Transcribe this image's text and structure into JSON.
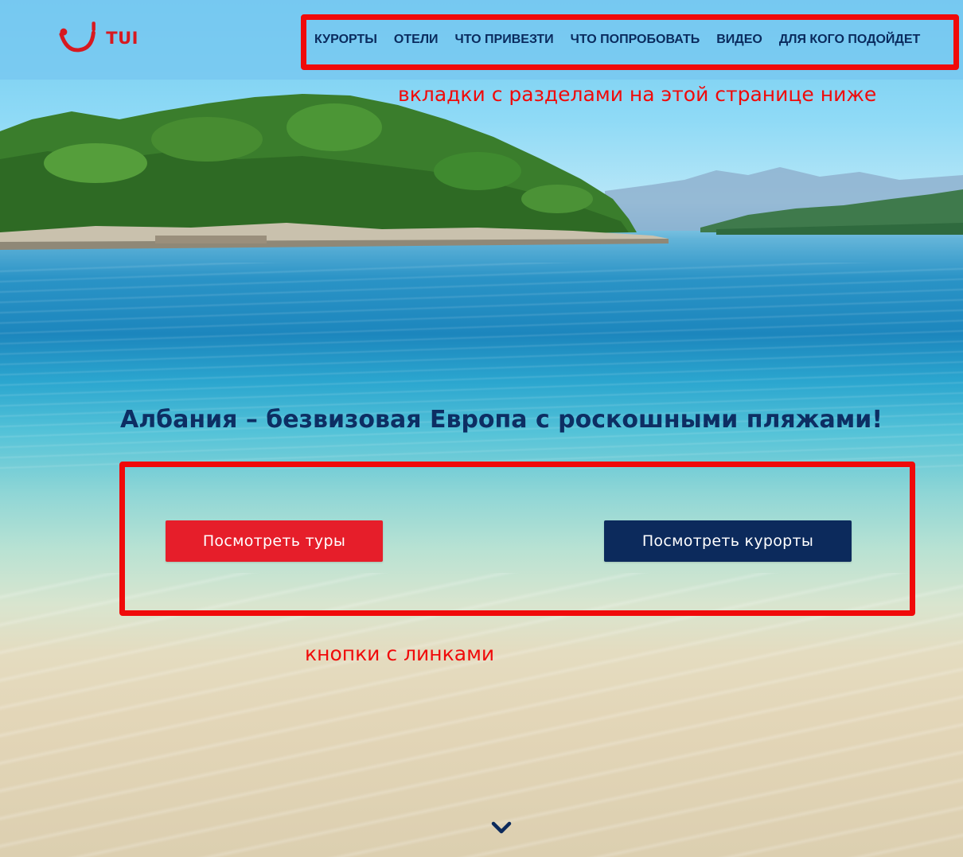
{
  "header": {
    "logo_text": "TUI",
    "nav": [
      {
        "label": "КУРОРТЫ"
      },
      {
        "label": "ОТЕЛИ"
      },
      {
        "label": "ЧТО ПРИВЕЗТИ"
      },
      {
        "label": "ЧТО ПОПРОБОВАТЬ"
      },
      {
        "label": "ВИДЕО"
      },
      {
        "label": "ДЛЯ КОГО ПОДОЙДЕТ"
      }
    ]
  },
  "hero": {
    "headline": "Албания – безвизовая Европа с роскошными пляжами!",
    "buttons": {
      "tours_label": "Посмотреть туры",
      "resorts_label": "Посмотреть курорты"
    },
    "scroll_icon": "chevron-down-icon"
  },
  "annotations": {
    "nav_note": "вкладки с разделами на этой странице ниже",
    "buttons_note": "кнопки с линками"
  },
  "colors": {
    "brand_red": "#e61e2a",
    "brand_navy": "#0c2a5c",
    "annotation_red": "#f00a0a"
  }
}
